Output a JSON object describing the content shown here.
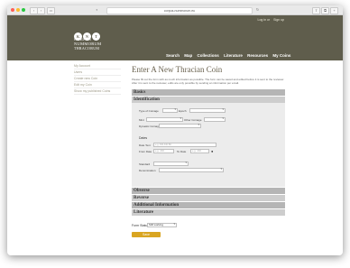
{
  "browser": {
    "url": "corpus-nummorum.eu"
  },
  "header": {
    "logo_letters": [
      "K",
      "N",
      "T"
    ],
    "brand_lines": [
      "CORPUS",
      "NUMMORUM",
      "THRACORUM"
    ],
    "top_links": [
      "Log in or",
      "Sign up"
    ],
    "nav": [
      "Search",
      "Map",
      "Collections",
      "Literature",
      "Resources",
      "My Coins"
    ]
  },
  "sidebar": {
    "items": [
      "My Account",
      "Users",
      "Create new Coin",
      "Edit my Coin",
      "Show my published Coins"
    ]
  },
  "main": {
    "title": "Enter A New Thracian Coin",
    "intro": "Please fill out the form with as much information as possible. The form can be saved and edited before it is sent to the reviewer. After it is sent to the reviewer, edits are only possible by sending an information per email.",
    "sections_top": [
      "Basics",
      "Identification"
    ],
    "sections_bottom": [
      "Obverse",
      "Reverse",
      "Additional Information",
      "Literature"
    ]
  },
  "form": {
    "coinage_type_label": "Type of Coinage",
    "epoch_label": "Epoch",
    "mint_label": "Mint",
    "other_coinage_label": "Other Coinage",
    "dynastic_coinage_label": "Dynastic Coinage",
    "dates_heading": "Dates",
    "date_text_label": "Date Text",
    "date_text_placeholder": "e.g. 336-330 BC",
    "from_date_label": "From Date",
    "from_date_placeholder": "e.g. -300",
    "to_date_label": "To Date",
    "to_date_placeholder": "e.g. -300",
    "standard_label": "Standard",
    "denomination_label": "Denomination"
  },
  "footer": {
    "form_status_label": "Form Status*",
    "form_status_value": "Still working",
    "save_label": "Save"
  }
}
